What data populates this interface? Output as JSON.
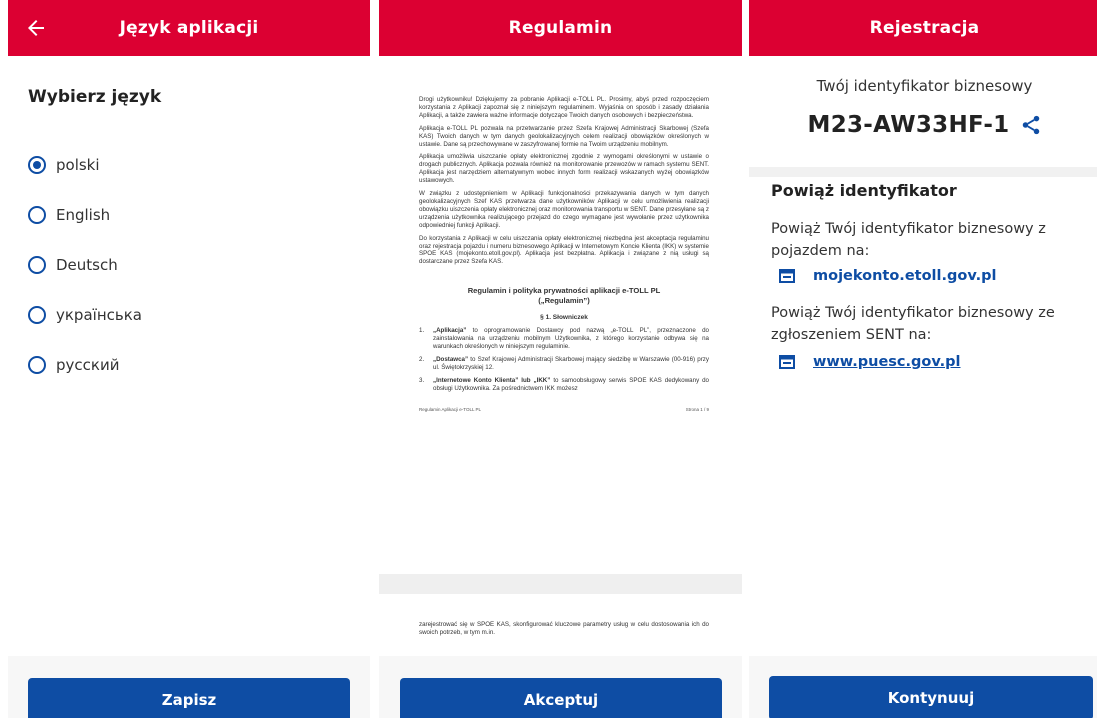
{
  "language_screen": {
    "title": "Język aplikacji",
    "heading": "Wybierz język",
    "languages": [
      {
        "label": "polski",
        "selected": true
      },
      {
        "label": "English",
        "selected": false
      },
      {
        "label": "Deutsch",
        "selected": false
      },
      {
        "label": "українська",
        "selected": false
      },
      {
        "label": "русский",
        "selected": false
      }
    ],
    "button": "Zapisz"
  },
  "terms_screen": {
    "title": "Regulamin",
    "intro_paragraphs": [
      "Drogi użytkowniku! Dziękujemy za pobranie Aplikacji e-TOLL PL. Prosimy, abyś przed rozpoczęciem korzystania z Aplikacji zapoznał się z niniejszym regulaminem. Wyjaśnia on sposób i zasady działania Aplikacji, a także zawiera ważne informacje dotyczące Twoich danych osobowych i bezpieczeństwa.",
      "Aplikacja e-TOLL PL pozwala na przetwarzanie przez Szefa Krajowej Administracji Skarbowej (Szefa KAS) Twoich danych w tym danych geolokalizacyjnych celem realizacji obowiązków określonych w ustawie. Dane są przechowywane w zaszyfrowanej formie na Twoim urządzeniu mobilnym.",
      "Aplikacja umożliwia uiszczanie opłaty elektronicznej zgodnie z wymogami określonymi w ustawie o drogach publicznych. Aplikacja pozwala również na monitorowanie przewozów w ramach systemu SENT. Aplikacja jest narzędziem alternatywnym wobec innych form realizacji wskazanych wyżej obowiązków ustawowych.",
      "W związku z udostępnieniem w Aplikacji funkcjonalności przekazywania danych w tym danych geolokalizacyjnych Szef KAS przetwarza dane użytkowników Aplikacji w celu umożliwienia realizacji obowiązku uiszczenia opłaty elektronicznej oraz monitorowania transportu w SENT. Dane przesyłane są z urządzenia użytkownika realizującego przejazd do czego wymagane jest wywołanie przez użytkownika odpowiedniej funkcji Aplikacji.",
      "Do korzystania z Aplikacji w celu uiszczania opłaty elektronicznej niezbędna jest akceptacja regulaminu oraz rejestracja pojazdu i numeru biznesowego Aplikacji w Internetowym Koncie Klienta (IKK) w systemie SPOE KAS (mojekonto.etoll.gov.pl). Aplikacja jest bezpłatna. Aplikacja i związane z nią usługi są dostarczane przez Szefa KAS."
    ],
    "doc_title_line1": "Regulamin i polityka prywatności aplikacji e-TOLL PL",
    "doc_title_line2": "(„Regulamin”)",
    "section": "§ 1. Słowniczek",
    "definitions": [
      {
        "num": "1.",
        "term": "„Aplikacja”",
        "text": " to oprogramowanie Dostawcy pod nazwą „e-TOLL PL”, przeznaczone do zainstalowania na urządzeniu mobilnym Użytkownika, z którego korzystanie odbywa się na warunkach określonych w niniejszym regulaminie."
      },
      {
        "num": "2.",
        "term": "„Dostawca”",
        "text": " to Szef Krajowej Administracji Skarbowej mający siedzibę w Warszawie (00-916) przy ul. Świętokrzyskiej 12."
      },
      {
        "num": "3.",
        "term": "„Internetowe Konto Klienta” lub „IKK”",
        "text": " to samoobsługowy serwis SPOE KAS dedykowany do obsługi Użytkownika. Za pośrednictwem IKK możesz"
      }
    ],
    "footer_left": "Regulamin Aplikacji e-TOLL PL",
    "footer_right": "Strona 1 / 9",
    "next_page_text": "zarejestrować się w SPOE KAS, skonfigurować kluczowe parametry usług w celu dostosowania ich do swoich potrzeb, w tym m.in.",
    "button": "Akceptuj"
  },
  "registration_screen": {
    "title": "Rejestracja",
    "id_label": "Twój identyfikator biznesowy",
    "id_value": "M23-AW33HF-1",
    "section_heading": "Powiąż identyfikator",
    "text1": "Powiąż Twój identyfikator biznesowy z pojazdem na:",
    "link1": "mojekonto.etoll.gov.pl",
    "text2": "Powiąż Twój identyfikator biznesowy ze zgłoszeniem SENT na:",
    "link2": "www.puesc.gov.pl",
    "button": "Kontynuuj"
  },
  "colors": {
    "brand_red": "#dc0032",
    "primary_blue": "#0e4da4"
  },
  "icons": [
    "arrow-left-icon",
    "share-icon",
    "browser-window-icon"
  ]
}
